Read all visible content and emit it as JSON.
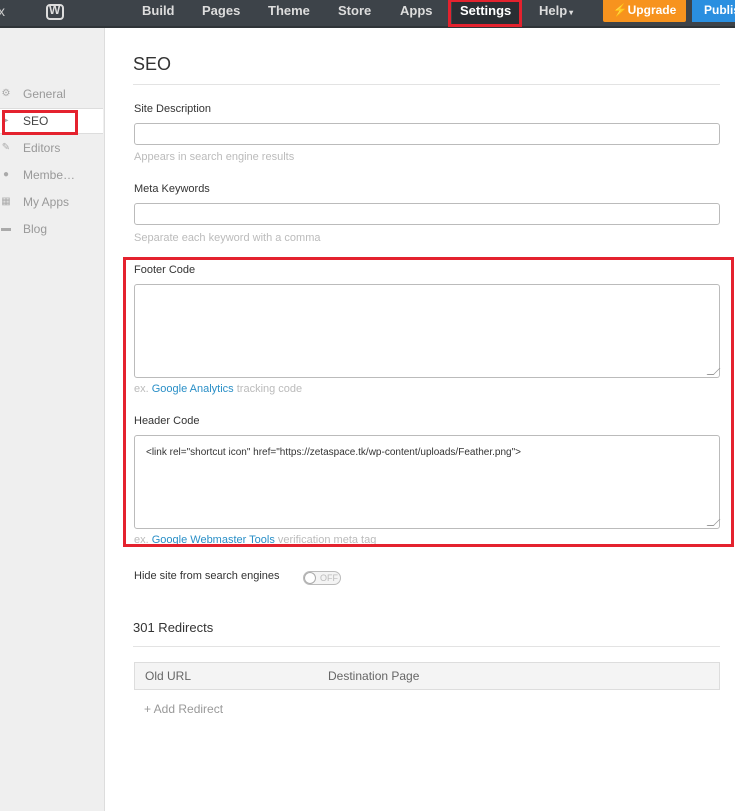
{
  "topbar": {
    "close_glyph": "x",
    "logo_letter": "W",
    "nav": [
      "Build",
      "Pages",
      "Theme",
      "Store",
      "Apps"
    ],
    "settings_label": "Settings",
    "help_label": "Help",
    "help_caret": "▾",
    "upgrade_label": "Upgrade",
    "upgrade_icon": "⚡",
    "publish_label": "Publis"
  },
  "sidebar": {
    "items": [
      {
        "icon": "gear-icon",
        "glyph": "⚙",
        "label": "General"
      },
      {
        "icon": "bullet-icon",
        "glyph": "▸",
        "label": "SEO"
      },
      {
        "icon": "pencil-icon",
        "glyph": "✎",
        "label": "Editors"
      },
      {
        "icon": "person-icon",
        "glyph": "●",
        "label": "Membe…"
      },
      {
        "icon": "grid-icon",
        "glyph": "▦",
        "label": "My Apps"
      },
      {
        "icon": "chat-icon",
        "glyph": "▬",
        "label": "Blog"
      }
    ]
  },
  "page": {
    "title": "SEO",
    "site_description": {
      "label": "Site Description",
      "value": "",
      "hint": "Appears in search engine results"
    },
    "meta_keywords": {
      "label": "Meta Keywords",
      "value": "",
      "hint": "Separate each keyword with a comma"
    },
    "footer_code": {
      "label": "Footer Code",
      "value": "",
      "hint_prefix": "ex. ",
      "hint_link": "Google Analytics",
      "hint_suffix": " tracking code"
    },
    "header_code": {
      "label": "Header Code",
      "value": "<link rel=\"shortcut icon\" href=\"https://zetaspace.tk/wp-content/uploads/Feather.png\">",
      "hint_prefix": "ex. ",
      "hint_link": "Google Webmaster Tools",
      "hint_suffix": " verification meta tag"
    },
    "hide_site": {
      "label": "Hide site from search engines",
      "state": "OFF"
    },
    "redirects": {
      "title": "301 Redirects",
      "columns": [
        "Old URL",
        "Destination Page"
      ],
      "add_label": "+ Add Redirect"
    }
  },
  "colors": {
    "accent_red": "#e4222e",
    "upgrade_orange": "#f7931e",
    "publish_blue": "#2a8fe0",
    "link_blue": "#2a8fc7"
  }
}
